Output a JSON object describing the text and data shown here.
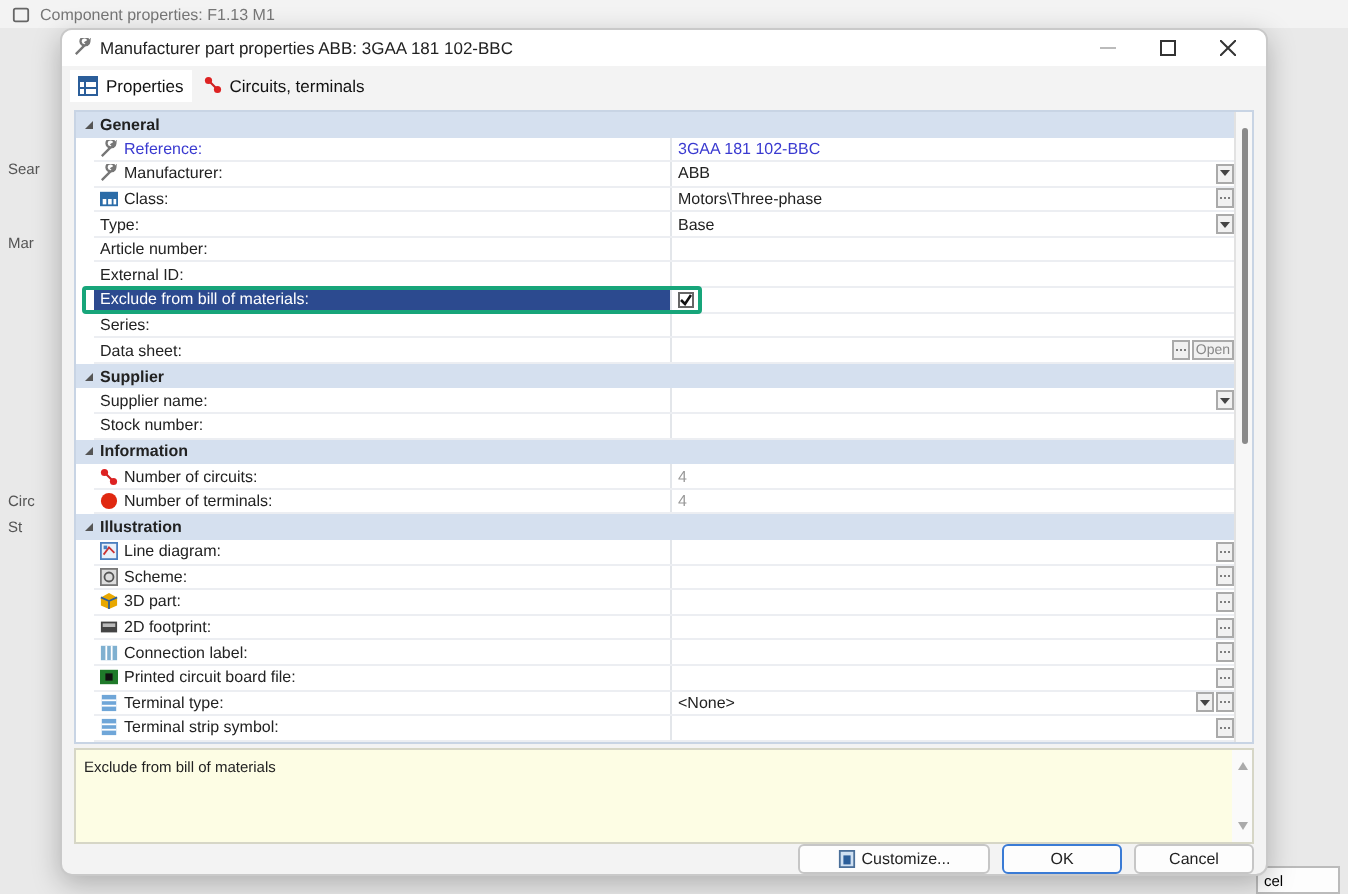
{
  "background_window": {
    "title": "Component properties: F1.13 M1",
    "fragments": [
      "Sear",
      "Mar",
      "Circ",
      "St"
    ],
    "button": "cel"
  },
  "dialog": {
    "title": "Manufacturer part properties ABB: 3GAA 181 102-BBC",
    "tabs": [
      {
        "label": "Properties",
        "kind": "grid",
        "selected": true
      },
      {
        "label": "Circuits, terminals",
        "kind": "circuit",
        "selected": false
      }
    ],
    "sections": [
      {
        "title": "General",
        "expanded": true,
        "rows": [
          {
            "label": "Reference:",
            "kind": "wrench",
            "value": "3GAA 181 102-BBC",
            "link": true
          },
          {
            "label": "Manufacturer:",
            "kind": "wrench",
            "value": "ABB",
            "dropdown": true
          },
          {
            "label": "Class:",
            "kind": "class",
            "value": "Motors\\Three-phase",
            "ellipsis": true
          },
          {
            "label": "Type:",
            "kind": "plain",
            "value": "Base",
            "dropdown": true
          },
          {
            "label": "Article number:",
            "kind": "plain"
          },
          {
            "label": "External ID:",
            "kind": "plain"
          },
          {
            "label": "Exclude from bill of materials:",
            "kind": "checkbox",
            "checked": true,
            "selected": true
          },
          {
            "label": "Series:",
            "kind": "plain"
          },
          {
            "label": "Data sheet:",
            "kind": "plain",
            "ellipsis": true,
            "open_button": "Open"
          }
        ]
      },
      {
        "title": "Supplier",
        "expanded": true,
        "rows": [
          {
            "label": "Supplier name:",
            "kind": "plain",
            "dropdown": true
          },
          {
            "label": "Stock number:",
            "kind": "plain"
          }
        ]
      },
      {
        "title": "Information",
        "expanded": true,
        "rows": [
          {
            "label": "Number of circuits:",
            "kind": "circuit",
            "value": "4",
            "readonly": true
          },
          {
            "label": "Number of terminals:",
            "kind": "terminal",
            "value": "4",
            "readonly": true
          }
        ]
      },
      {
        "title": "Illustration",
        "expanded": true,
        "rows": [
          {
            "label": "Line diagram:",
            "kind": "diagram",
            "ellipsis": true
          },
          {
            "label": "Scheme:",
            "kind": "scheme",
            "ellipsis": true
          },
          {
            "label": "3D part:",
            "kind": "part3d",
            "ellipsis": true
          },
          {
            "label": "2D footprint:",
            "kind": "footprint",
            "ellipsis": true
          },
          {
            "label": "Connection label:",
            "kind": "label",
            "ellipsis": true
          },
          {
            "label": "Printed circuit board file:",
            "kind": "pcb",
            "ellipsis": true
          },
          {
            "label": "Terminal type:",
            "kind": "terminaltype",
            "value": "<None>",
            "dropdown": true,
            "ellipsis": true
          },
          {
            "label": "Terminal strip symbol:",
            "kind": "terminaltype",
            "ellipsis": true
          }
        ]
      }
    ],
    "description": "Exclude from bill of materials",
    "buttons": [
      {
        "label": "Customize...",
        "kind": "customize"
      },
      {
        "label": "OK",
        "kind": "default"
      },
      {
        "label": "Cancel",
        "kind": "normal"
      }
    ]
  }
}
